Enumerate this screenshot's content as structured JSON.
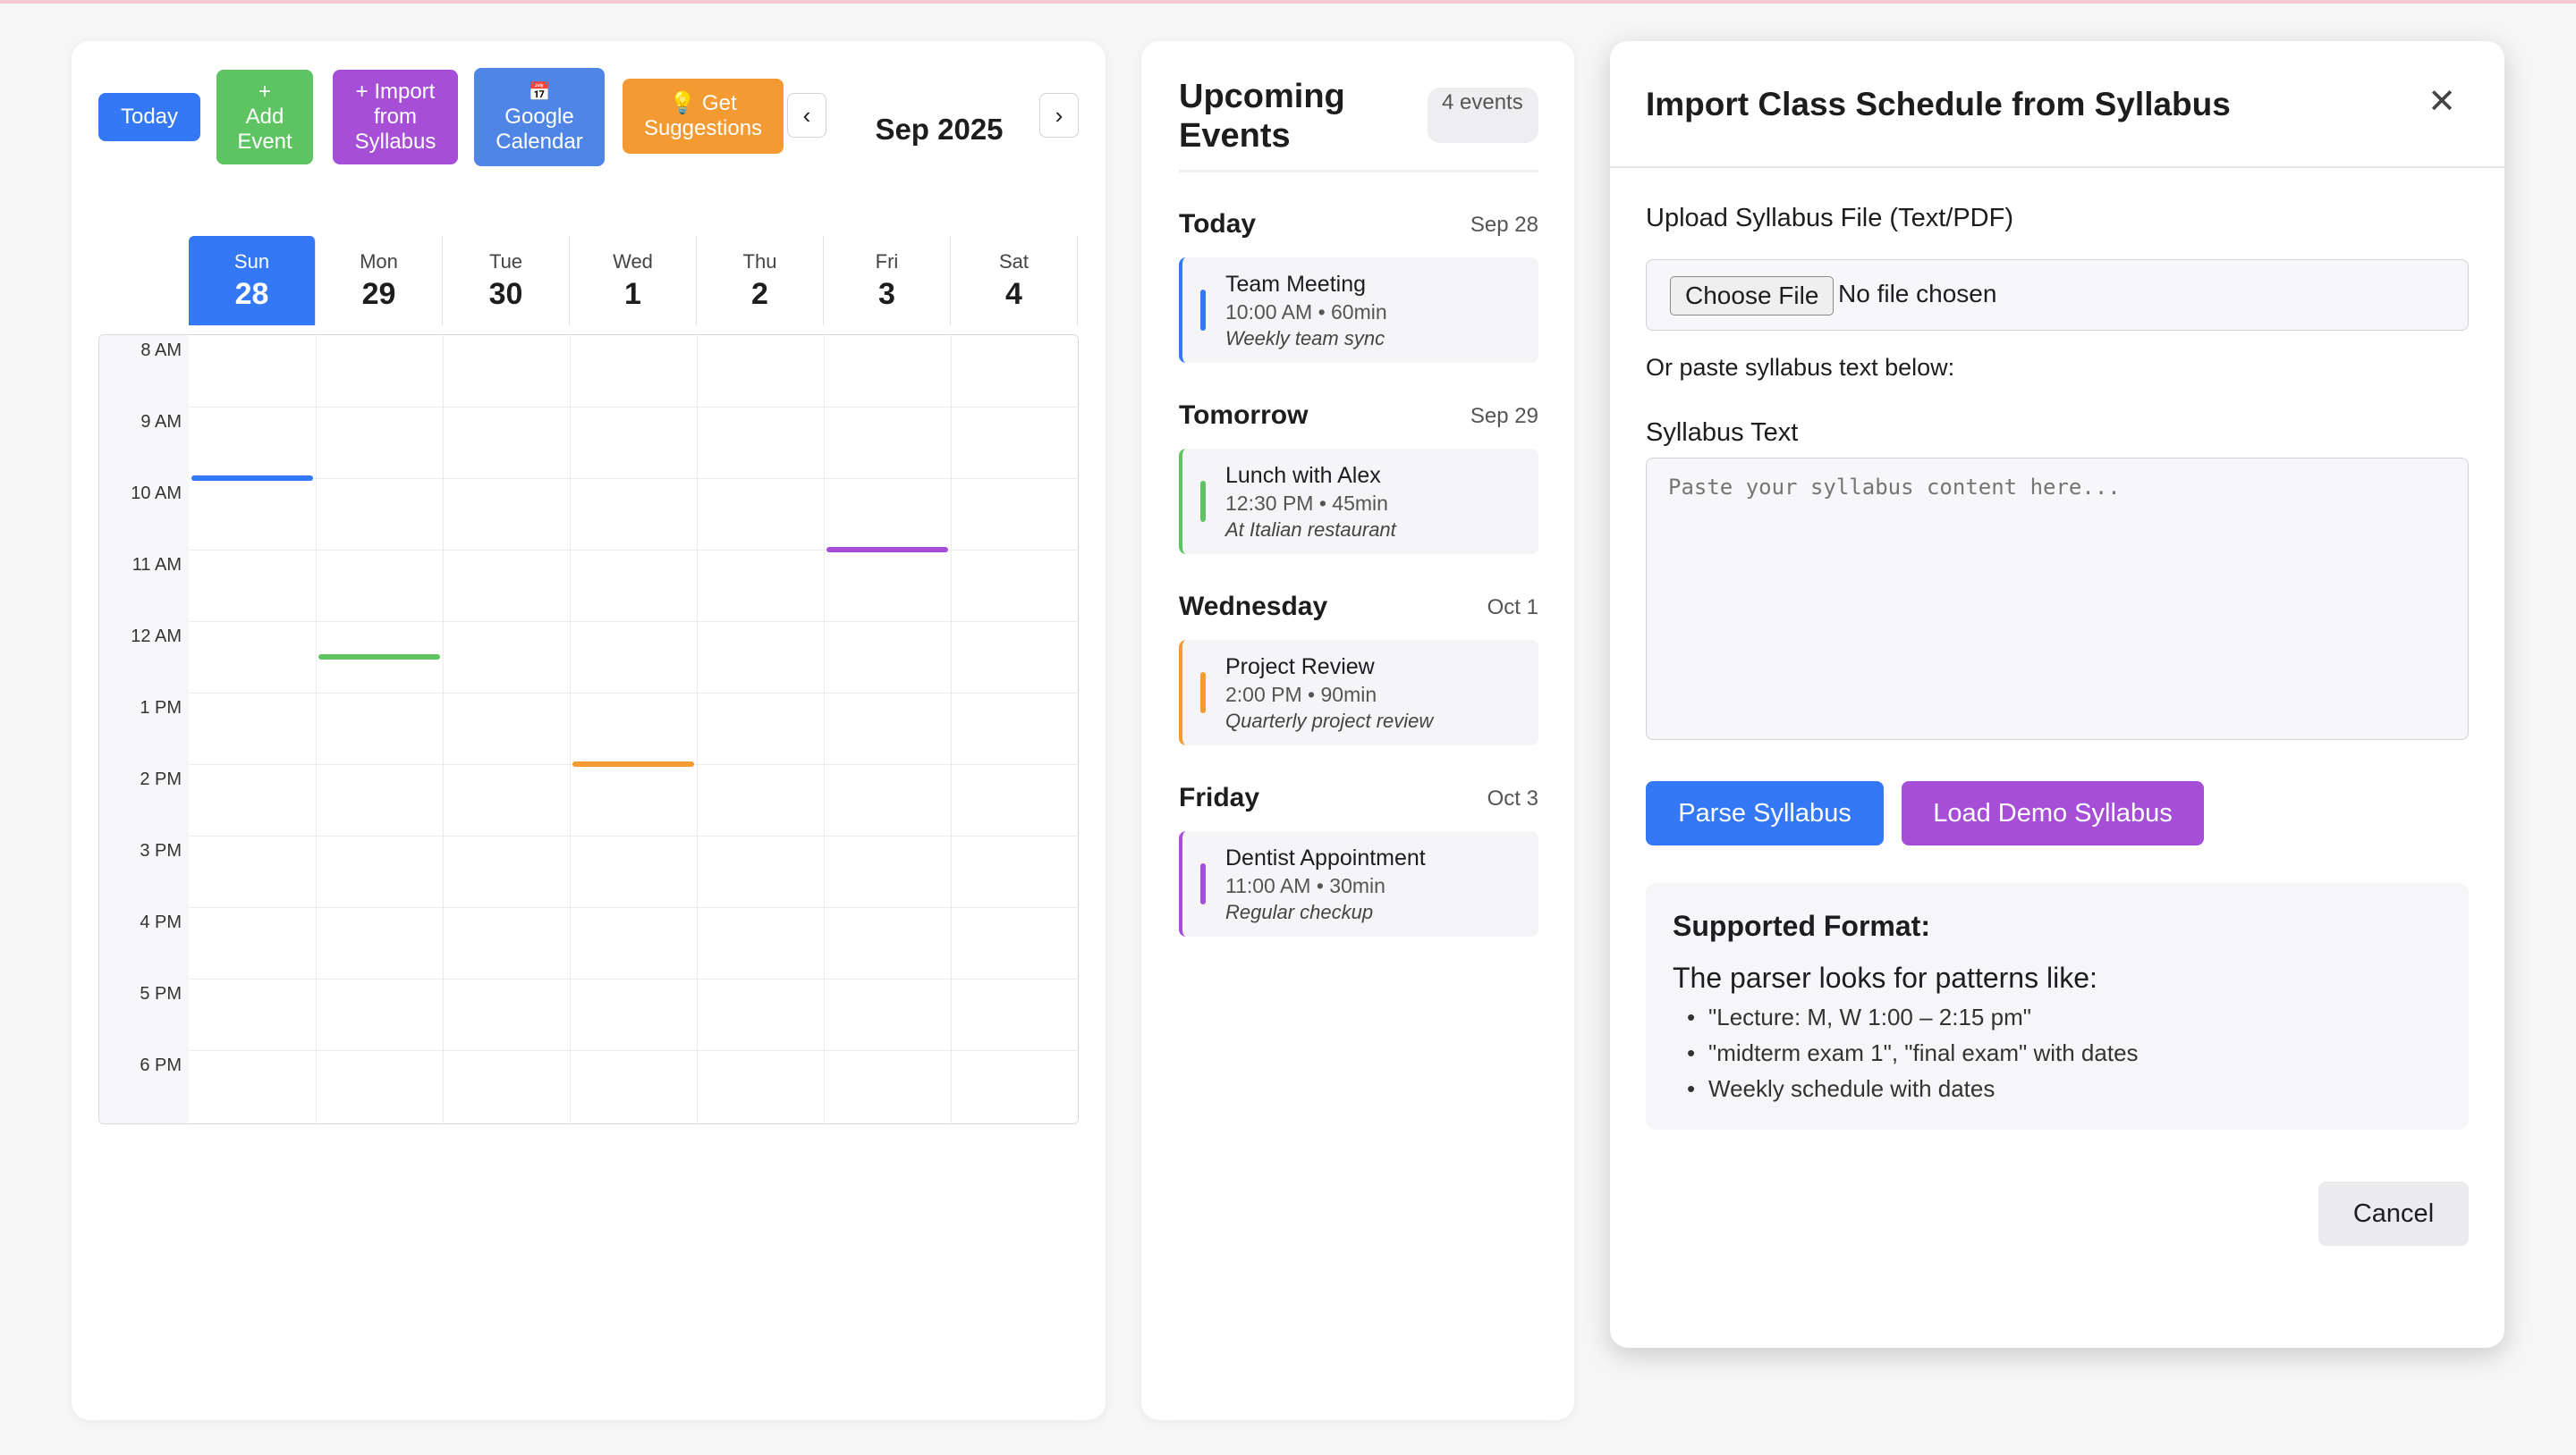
{
  "toolbar": {
    "today": "Today",
    "add_event": [
      "+",
      "Add",
      "Event"
    ],
    "import": [
      "+ Import",
      "from",
      "Syllabus"
    ],
    "google": [
      "📅",
      "Google",
      "Calendar"
    ],
    "suggest": [
      "💡 Get",
      "Suggestions"
    ],
    "prev": "‹",
    "next": "›",
    "month": "Sep 2025"
  },
  "days": [
    {
      "name": "Sun",
      "date": "28",
      "today": true
    },
    {
      "name": "Mon",
      "date": "29"
    },
    {
      "name": "Tue",
      "date": "30"
    },
    {
      "name": "Wed",
      "date": "1"
    },
    {
      "name": "Thu",
      "date": "2"
    },
    {
      "name": "Fri",
      "date": "3"
    },
    {
      "name": "Sat",
      "date": "4"
    }
  ],
  "hours": [
    "8 AM",
    "9 AM",
    "10 AM",
    "11 AM",
    "12 AM",
    "1 PM",
    "2 PM",
    "3 PM",
    "4 PM",
    "5 PM",
    "6 PM"
  ],
  "grid_events": [
    {
      "day": 0,
      "start": 10.0,
      "color": "#3478f6"
    },
    {
      "day": 1,
      "start": 12.5,
      "color": "#5ec462"
    },
    {
      "day": 3,
      "start": 14.0,
      "color": "#f39a33"
    },
    {
      "day": 5,
      "start": 11.0,
      "color": "#a64fd6"
    }
  ],
  "upcoming": {
    "title": "Upcoming Events",
    "count": "4 events",
    "groups": [
      {
        "label": "Today",
        "date": "Sep 28",
        "title": "Team Meeting",
        "meta": "10:00 AM • 60min",
        "desc": "Weekly team sync",
        "color": "#3478f6"
      },
      {
        "label": "Tomorrow",
        "date": "Sep 29",
        "title": "Lunch with Alex",
        "meta": "12:30 PM • 45min",
        "desc": "At Italian restaurant",
        "color": "#5ec462"
      },
      {
        "label": "Wednesday",
        "date": "Oct 1",
        "title": "Project Review",
        "meta": "2:00 PM • 90min",
        "desc": "Quarterly project review",
        "color": "#f39a33"
      },
      {
        "label": "Friday",
        "date": "Oct 3",
        "title": "Dentist Appointment",
        "meta": "11:00 AM • 30min",
        "desc": "Regular checkup",
        "color": "#a64fd6"
      }
    ]
  },
  "modal": {
    "title": "Import Class Schedule from Syllabus",
    "close": "✕",
    "upload_label": "Upload Syllabus File (Text/PDF)",
    "choose_file": "Choose File",
    "no_file": "No file chosen",
    "or_paste": "Or paste syllabus text below:",
    "text_label": "Syllabus Text",
    "placeholder": "Paste your syllabus content here...",
    "parse": "Parse Syllabus",
    "demo": "Load Demo Syllabus",
    "format_title": "Supported Format:",
    "format_sub": "The parser looks for patterns like:",
    "format_items": [
      "\"Lecture: M, W 1:00 – 2:15 pm\"",
      "\"midterm exam 1\", \"final exam\" with dates",
      "Weekly schedule with dates"
    ],
    "cancel": "Cancel"
  },
  "colors": {
    "blue": "#3478f6",
    "green": "#5ec462",
    "purple": "#a64fd6",
    "google": "#4f86e6",
    "orange": "#f39a33"
  }
}
